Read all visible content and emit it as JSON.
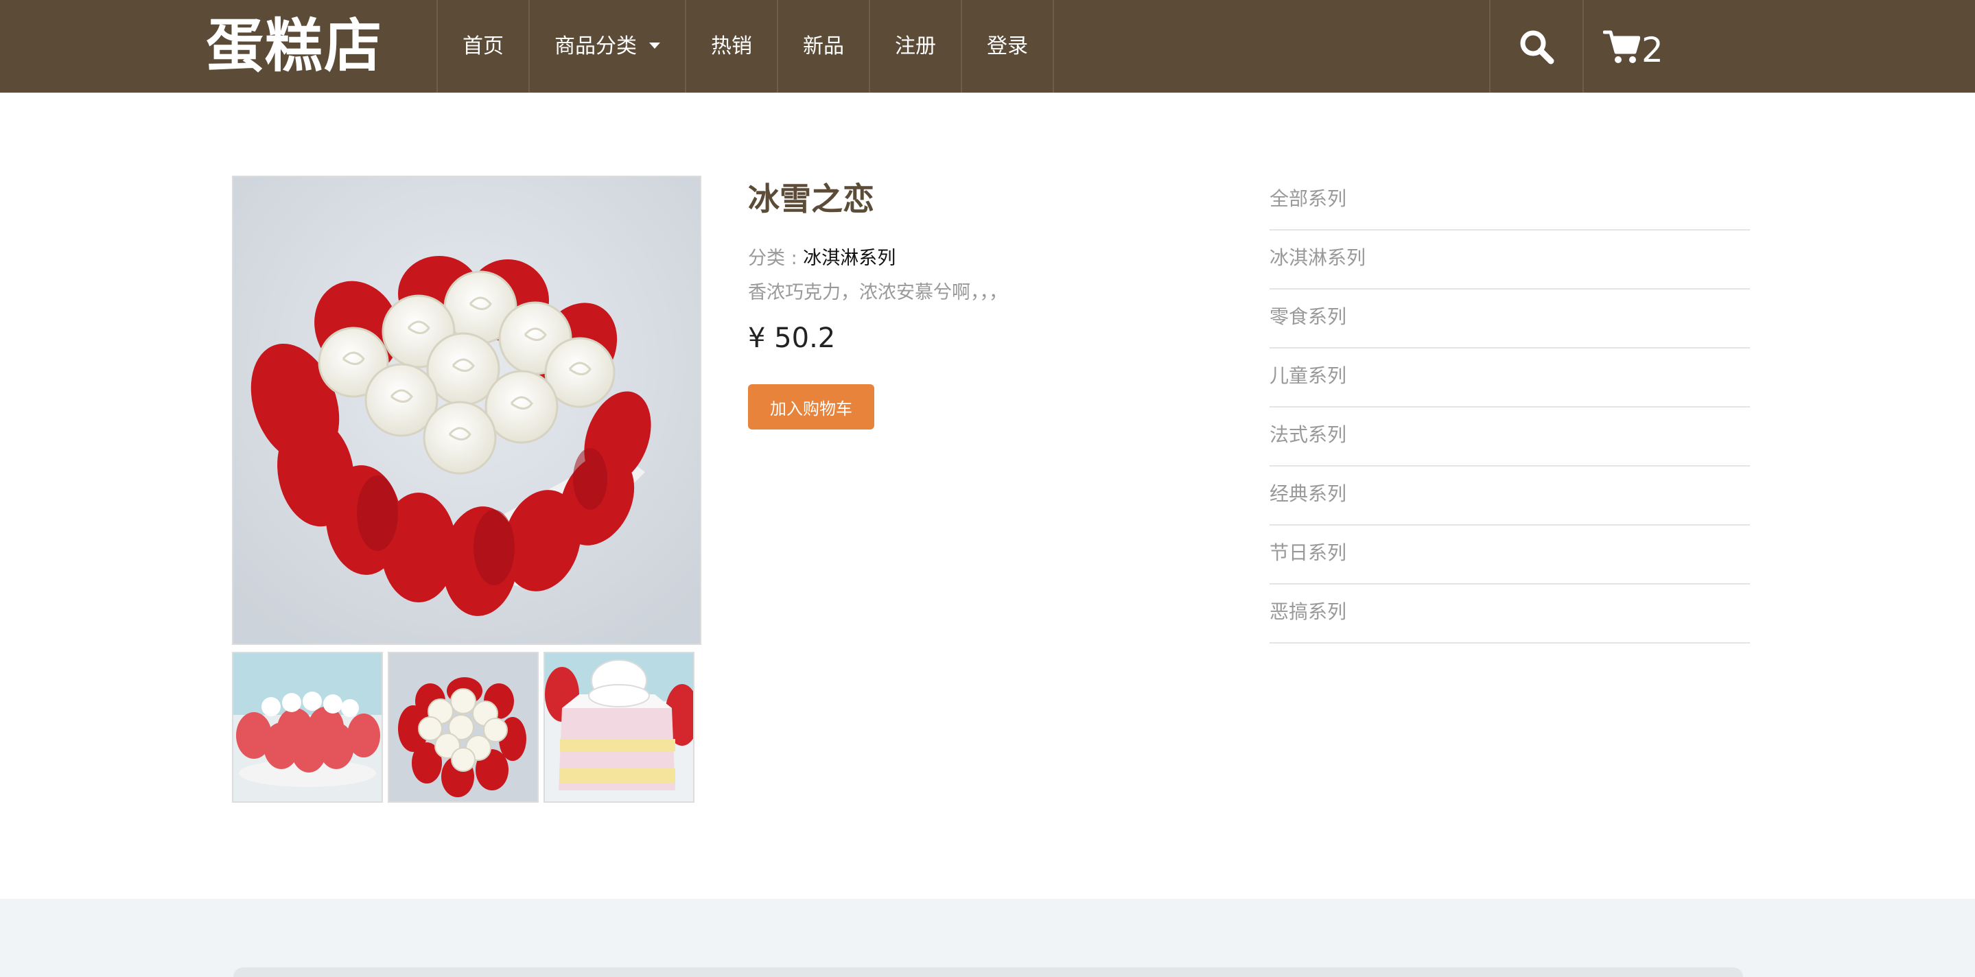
{
  "header": {
    "logo": "蛋糕店",
    "nav": [
      {
        "label": "首页"
      },
      {
        "label": "商品分类"
      },
      {
        "label": "热销"
      },
      {
        "label": "新品"
      },
      {
        "label": "注册"
      },
      {
        "label": "登录"
      }
    ],
    "search_icon": "search-icon",
    "cart_icon": "shopping-cart-icon",
    "cart_count": "2"
  },
  "product": {
    "title": "冰雪之恋",
    "category_label": "分类 : ",
    "category_value": "冰淇淋系列",
    "description": "香浓巧克力，浓浓安慕兮啊，，，",
    "price": "¥ 50.2",
    "add_to_cart": "加入购物车"
  },
  "sidebar": {
    "items": [
      {
        "label": "全部系列"
      },
      {
        "label": "冰淇淋系列"
      },
      {
        "label": "零食系列"
      },
      {
        "label": "儿童系列"
      },
      {
        "label": "法式系列"
      },
      {
        "label": "经典系列"
      },
      {
        "label": "节日系列"
      },
      {
        "label": "恶搞系列"
      }
    ]
  },
  "colors": {
    "header_bg": "#5b4b37",
    "button_bg": "#e7833a",
    "title_color": "#5b4b37",
    "petal_red": "#c8161d"
  }
}
